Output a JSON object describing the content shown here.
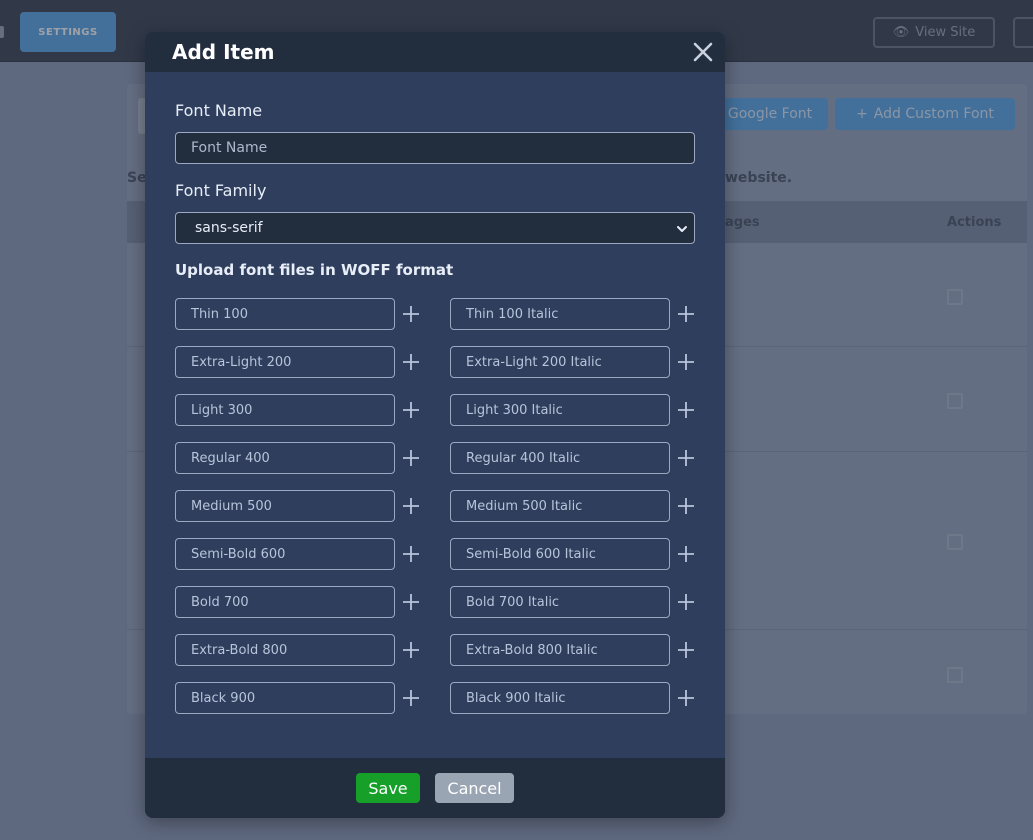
{
  "background": {
    "settings_label": "SETTINGS",
    "view_site_label": "View Site",
    "google_font_label": "Google Font",
    "custom_font_label": "Add Custom Font",
    "description_left": "Se",
    "description_right": "website.",
    "table_pages_header": "ages",
    "table_actions_header": "Actions"
  },
  "modal": {
    "title": "Add Item",
    "font_name_label": "Font Name",
    "font_name_placeholder": "Font Name",
    "font_family_label": "Font Family",
    "font_family_value": "sans-serif",
    "upload_label": "Upload font files in WOFF format",
    "weights_left": [
      "Thin 100",
      "Extra-Light 200",
      "Light 300",
      "Regular 400",
      "Medium 500",
      "Semi-Bold 600",
      "Bold 700",
      "Extra-Bold 800",
      "Black 900"
    ],
    "weights_right": [
      "Thin 100 Italic",
      "Extra-Light 200 Italic",
      "Light 300 Italic",
      "Regular 400 Italic",
      "Medium 500 Italic",
      "Semi-Bold 600 Italic",
      "Bold 700 Italic",
      "Extra-Bold 800 Italic",
      "Black 900 Italic"
    ],
    "save_label": "Save",
    "cancel_label": "Cancel"
  },
  "colors": {
    "modal_bg": "#2e3e5c",
    "header_bg": "#222d3e",
    "save": "#16a02a",
    "cancel": "#9aa5b4",
    "accent_blue": "#58a6ea"
  }
}
